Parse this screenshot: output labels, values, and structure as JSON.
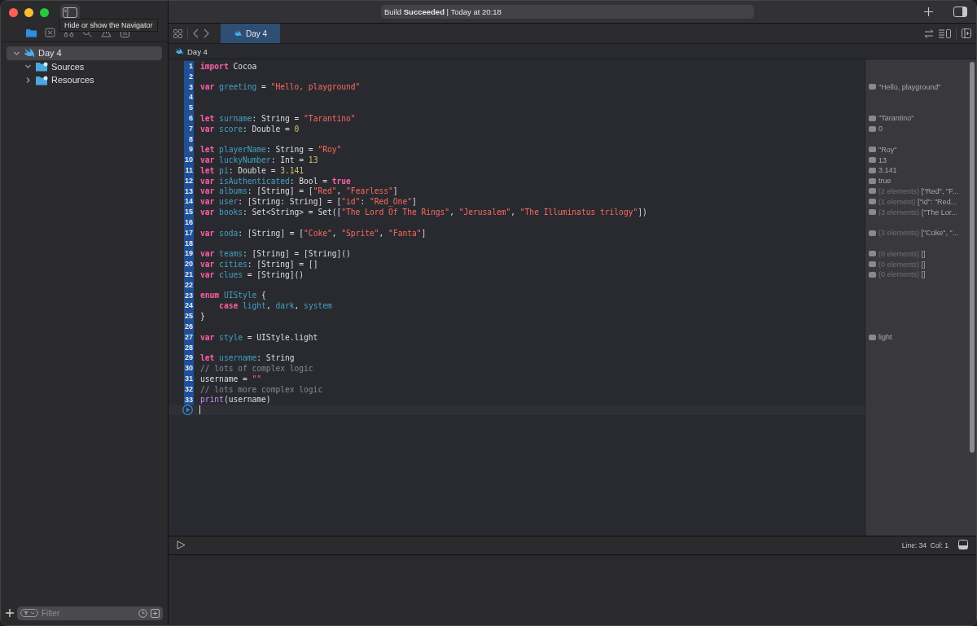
{
  "window": {
    "activity": "Build **Succeeded** | Today at 20:18",
    "tooltip": "Hide or show the Navigator"
  },
  "navigator_tabs": [
    {
      "selected": true
    },
    {
      "selected": false
    },
    {
      "selected": false
    },
    {
      "selected": false
    },
    {
      "selected": false
    },
    {
      "selected": false
    }
  ],
  "tree": [
    {
      "label": "Day 4",
      "expanded": true,
      "selected": true,
      "children": [
        {
          "label": "Sources",
          "expanded": true,
          "selected": false
        },
        {
          "label": "Resources",
          "expanded": false,
          "selected": false
        }
      ]
    }
  ],
  "filter": {
    "placeholder": "Filter"
  },
  "editor_tabs": [
    {
      "label": "Day 4",
      "selected": true
    }
  ],
  "breadcrumb": "Day 4",
  "lines": [
    {
      "number": "1",
      "tokens": [
        {
          "kind": "kw",
          "text": "import"
        },
        {
          "kind": "plain",
          "text": " Cocoa"
        }
      ]
    },
    {
      "number": "2"
    },
    {
      "number": "3",
      "tokens": [
        {
          "kind": "kw",
          "text": "var"
        },
        {
          "kind": "decl",
          "text": " greeting"
        },
        {
          "kind": "plain",
          "text": " = "
        },
        {
          "kind": "str",
          "text": "\"Hello, playground\""
        }
      ],
      "result": {
        "value": "\"Hello, playground\""
      }
    },
    {
      "number": "4"
    },
    {
      "number": "5"
    },
    {
      "number": "6",
      "tokens": [
        {
          "kind": "kw",
          "text": "let"
        },
        {
          "kind": "decl",
          "text": " surname"
        },
        {
          "kind": "plain",
          "text": ": String = "
        },
        {
          "kind": "str",
          "text": "\"Tarantino\""
        }
      ],
      "result": {
        "value": "\"Tarantino\""
      }
    },
    {
      "number": "7",
      "tokens": [
        {
          "kind": "kw",
          "text": "var"
        },
        {
          "kind": "decl",
          "text": " score"
        },
        {
          "kind": "plain",
          "text": ": Double = "
        },
        {
          "kind": "num",
          "text": "0"
        }
      ],
      "result": {
        "value": "0"
      }
    },
    {
      "number": "8"
    },
    {
      "number": "9",
      "tokens": [
        {
          "kind": "kw",
          "text": "let"
        },
        {
          "kind": "decl",
          "text": " playerName"
        },
        {
          "kind": "plain",
          "text": ": String = "
        },
        {
          "kind": "str",
          "text": "\"Roy\""
        }
      ],
      "result": {
        "value": "\"Roy\""
      }
    },
    {
      "number": "10",
      "tokens": [
        {
          "kind": "kw",
          "text": "var"
        },
        {
          "kind": "decl",
          "text": " luckyNumber"
        },
        {
          "kind": "plain",
          "text": ": Int = "
        },
        {
          "kind": "num",
          "text": "13"
        }
      ],
      "result": {
        "value": "13"
      }
    },
    {
      "number": "11",
      "tokens": [
        {
          "kind": "kw",
          "text": "let"
        },
        {
          "kind": "decl",
          "text": " pi"
        },
        {
          "kind": "plain",
          "text": ": Double = "
        },
        {
          "kind": "num",
          "text": "3.141"
        }
      ],
      "result": {
        "value": "3.141"
      }
    },
    {
      "number": "12",
      "tokens": [
        {
          "kind": "kw",
          "text": "var"
        },
        {
          "kind": "decl",
          "text": " isAuthenticated"
        },
        {
          "kind": "plain",
          "text": ": Bool = "
        },
        {
          "kind": "kw",
          "text": "true"
        }
      ],
      "result": {
        "value": "true"
      }
    },
    {
      "number": "13",
      "tokens": [
        {
          "kind": "kw",
          "text": "var"
        },
        {
          "kind": "decl",
          "text": " albums"
        },
        {
          "kind": "plain",
          "text": ": [String] = ["
        },
        {
          "kind": "str",
          "text": "\"Red\""
        },
        {
          "kind": "plain",
          "text": ", "
        },
        {
          "kind": "str",
          "text": "\"Fearless\""
        },
        {
          "kind": "plain",
          "text": "]"
        }
      ],
      "result": {
        "count": "(2 elements)",
        "value": "[\"Red\", \"F..."
      }
    },
    {
      "number": "14",
      "tokens": [
        {
          "kind": "kw",
          "text": "var"
        },
        {
          "kind": "decl",
          "text": " user"
        },
        {
          "kind": "plain",
          "text": ": [String: String] = ["
        },
        {
          "kind": "str",
          "text": "\"id\""
        },
        {
          "kind": "plain",
          "text": ": "
        },
        {
          "kind": "str",
          "text": "\"Red_One\""
        },
        {
          "kind": "plain",
          "text": "]"
        }
      ],
      "result": {
        "count": "(1 element)",
        "value": "[\"id\": \"Red..."
      }
    },
    {
      "number": "15",
      "tokens": [
        {
          "kind": "kw",
          "text": "var"
        },
        {
          "kind": "decl",
          "text": " books"
        },
        {
          "kind": "plain",
          "text": ": Set<String> = Set(["
        },
        {
          "kind": "str",
          "text": "\"The Lord Of The Rings\""
        },
        {
          "kind": "plain",
          "text": ", "
        },
        {
          "kind": "str",
          "text": "\"Jerusalem\""
        },
        {
          "kind": "plain",
          "text": ", "
        },
        {
          "kind": "str",
          "text": "\"The Illuminatus trilogy\""
        },
        {
          "kind": "plain",
          "text": "])"
        }
      ],
      "result": {
        "count": "(3 elements)",
        "value": "{\"The Lor..."
      }
    },
    {
      "number": "16"
    },
    {
      "number": "17",
      "tokens": [
        {
          "kind": "kw",
          "text": "var"
        },
        {
          "kind": "decl",
          "text": " soda"
        },
        {
          "kind": "plain",
          "text": ": [String] = ["
        },
        {
          "kind": "str",
          "text": "\"Coke\""
        },
        {
          "kind": "plain",
          "text": ", "
        },
        {
          "kind": "str",
          "text": "\"Sprite\""
        },
        {
          "kind": "plain",
          "text": ", "
        },
        {
          "kind": "str",
          "text": "\"Fanta\""
        },
        {
          "kind": "plain",
          "text": "]"
        }
      ],
      "result": {
        "count": "(3 elements)",
        "value": "[\"Coke\", \"..."
      }
    },
    {
      "number": "18"
    },
    {
      "number": "19",
      "tokens": [
        {
          "kind": "kw",
          "text": "var"
        },
        {
          "kind": "decl",
          "text": " teams"
        },
        {
          "kind": "plain",
          "text": ": [String] = [String]()"
        }
      ],
      "result": {
        "count": "(0 elements)",
        "value": "[]"
      }
    },
    {
      "number": "20",
      "tokens": [
        {
          "kind": "kw",
          "text": "var"
        },
        {
          "kind": "decl",
          "text": " cities"
        },
        {
          "kind": "plain",
          "text": ": [String] = []"
        }
      ],
      "result": {
        "count": "(0 elements)",
        "value": "[]"
      }
    },
    {
      "number": "21",
      "tokens": [
        {
          "kind": "kw",
          "text": "var"
        },
        {
          "kind": "decl",
          "text": " clues"
        },
        {
          "kind": "plain",
          "text": " = [String]()"
        }
      ],
      "result": {
        "count": "(0 elements)",
        "value": "[]"
      }
    },
    {
      "number": "22"
    },
    {
      "number": "23",
      "tokens": [
        {
          "kind": "kw",
          "text": "enum"
        },
        {
          "kind": "decl",
          "text": " UIStyle"
        },
        {
          "kind": "plain",
          "text": " {"
        }
      ]
    },
    {
      "number": "24",
      "tokens": [
        {
          "kind": "kw",
          "text": "    case"
        },
        {
          "kind": "decl",
          "text": " light"
        },
        {
          "kind": "plain",
          "text": ", "
        },
        {
          "kind": "decl",
          "text": "dark"
        },
        {
          "kind": "plain",
          "text": ", "
        },
        {
          "kind": "decl",
          "text": "system"
        }
      ]
    },
    {
      "number": "25",
      "tokens": [
        {
          "kind": "plain",
          "text": "}"
        }
      ]
    },
    {
      "number": "26"
    },
    {
      "number": "27",
      "tokens": [
        {
          "kind": "kw",
          "text": "var"
        },
        {
          "kind": "decl",
          "text": " style"
        },
        {
          "kind": "plain",
          "text": " = UIStyle.light"
        }
      ],
      "result": {
        "value": "light"
      }
    },
    {
      "number": "28"
    },
    {
      "number": "29",
      "tokens": [
        {
          "kind": "kw",
          "text": "let"
        },
        {
          "kind": "decl",
          "text": " username"
        },
        {
          "kind": "plain",
          "text": ": String"
        }
      ]
    },
    {
      "number": "30",
      "tokens": [
        {
          "kind": "cmt",
          "text": "// lots of complex logic"
        }
      ]
    },
    {
      "number": "31",
      "tokens": [
        {
          "kind": "plain",
          "text": "username = "
        },
        {
          "kind": "str",
          "text": "\"\""
        }
      ]
    },
    {
      "number": "32",
      "tokens": [
        {
          "kind": "cmt",
          "text": "// lots more complex logic"
        }
      ]
    },
    {
      "number": "33",
      "tokens": [
        {
          "kind": "fn",
          "text": "print"
        },
        {
          "kind": "plain",
          "text": "(username)"
        }
      ]
    }
  ],
  "status": "Line: 34  Col: 1"
}
